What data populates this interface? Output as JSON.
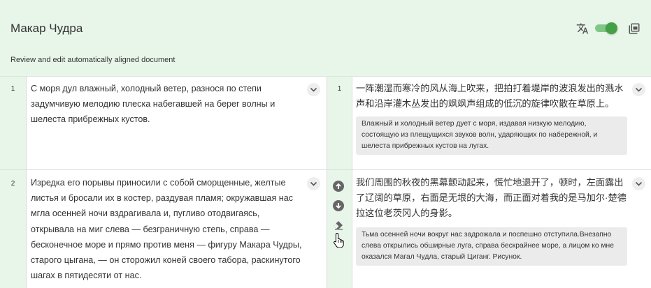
{
  "header": {
    "title": "Макар Чудра",
    "subtitle": "Review and edit automatically aligned document",
    "translate_icon": "translate-icon",
    "toggle_state": "on",
    "toggle_color": "#43a047",
    "copy_icon": "copy-icon",
    "background": "#e8f5e9"
  },
  "rows": [
    {
      "source_number": "1",
      "source_text": "С моря дул влажный, холодный ветер, разнося по степи задумчивую мелодию плеска набегавшей на берег волны и шелеста прибрежных кустов.",
      "target_number": "1",
      "target_text": "一阵潮湿而寒冷的风从海上吹来，把拍打着堤岸的波浪发出的溅水声和沿岸灌木丛发出的飒飒声组成的低沉的旋律吹散在草原上。",
      "back_translation": "Влажный и холодный ветер дует с моря, издавая низкую мелодию, состоящую из плещущихся звуков волн, ударяющих по набережной, и шелеста прибрежных кустов на лугах."
    },
    {
      "source_number": "2",
      "source_text": "Изредка его порывы приносили с собой сморщенные, желтые листья и бросали их в костер, раздувая пламя; окружавшая нас мгла осенней ночи вздрагивала и, пугливо отодвигаясь, открывала на миг слева — безграничную степь, справа — бесконечное море и прямо против меня — фигуру Макара Чудры, старого цыгана, — он сторожил коней своего табора, раскинутого шагах в пятидесяти от нас.",
      "target_text": "我们周围的秋夜的黑幕颤动起来，慌忙地退开了，顿时，左面露出了辽阔的草原，右面是无垠的大海，而正面对着我的是马加尔·楚德拉这位老茨冈人的身影。",
      "back_translation": "Тьма осенней ночи вокруг нас задрожала и поспешно отступила.Внезапно слева открылись обширные луга, справа бескрайнее море, а лицом ко мне оказался Магал Чудла, старый Циганг. Рисунок."
    }
  ],
  "row_actions": [
    "arrow-up-circle-icon",
    "arrow-down-circle-icon",
    "eraser-icon"
  ],
  "pointer": "hand-pointer-cursor"
}
